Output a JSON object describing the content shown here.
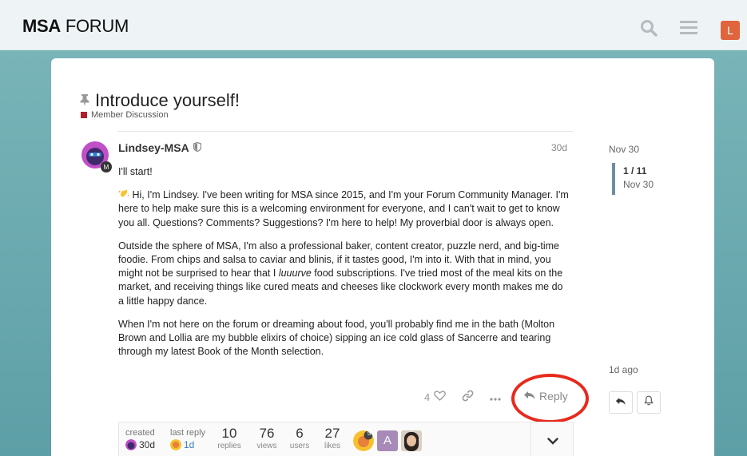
{
  "header": {
    "logo_bold": "MSA",
    "logo_light": "FORUM",
    "user_initial": "L",
    "accent": "#e0643c"
  },
  "topic": {
    "title": "Introduce yourself!",
    "category": "Member Discussion",
    "category_color": "#b11f2e"
  },
  "post": {
    "author": "Lindsey-MSA",
    "date": "30d",
    "paragraphs": [
      "I'll start!",
      "Hi, I'm Lindsey. I've been writing for MSA since 2015, and I'm your Forum Community Manager. I'm here to help make sure this is a welcoming environment for everyone, and I can't wait to get to know you all. Questions? Comments? Suggestions? I'm here to help! My proverbial door is always open.",
      "Outside the sphere of MSA, I'm also a professional baker, content creator, puzzle nerd, and big-time foodie. From chips and salsa to caviar and blinis, if it tastes good, I'm into it. With that in mind, you might not be surprised to hear that I ",
      "luuurve",
      " food subscriptions. I've tried most of the meal kits on the market, and receiving things like cured meats and cheeses like clockwork every month makes me do a little happy dance.",
      "When I'm not here on the forum or dreaming about food, you'll probably find me in the bath (Molton Brown and Lollia are my bubble elixirs of choice) sipping an ice cold glass of Sancerre and tearing through my latest Book of the Month selection."
    ],
    "like_count": "4",
    "reply_label": "Reply"
  },
  "topic_map": {
    "created_label": "created",
    "created_value": "30d",
    "last_reply_label": "last reply",
    "last_reply_value": "1d",
    "stats": [
      {
        "num": "10",
        "label": "replies"
      },
      {
        "num": "76",
        "label": "views"
      },
      {
        "num": "6",
        "label": "users"
      },
      {
        "num": "27",
        "label": "likes"
      }
    ],
    "participant_badge": "5",
    "participant_initial": "A"
  },
  "timeline": {
    "start_date": "Nov 30",
    "position": "1 / 11",
    "position_date": "Nov 30",
    "end_label": "1d ago"
  }
}
